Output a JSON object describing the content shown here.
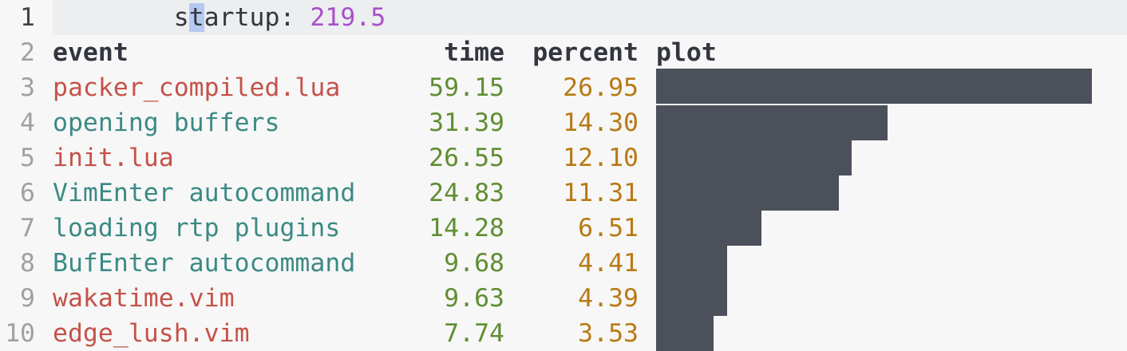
{
  "startup": {
    "label_before_cursor": "        s",
    "cursor_char": "t",
    "label_after_cursor": "artup: ",
    "value": "219.5"
  },
  "header": {
    "event": "event",
    "time": "time",
    "percent": "percent",
    "plot": "plot"
  },
  "line_numbers": [
    "1",
    "2",
    "3",
    "4",
    "5",
    "6",
    "7",
    "8",
    "9",
    "10"
  ],
  "rows": [
    {
      "event": "packer_compiled.lua",
      "time": "59.15",
      "percent": "26.95",
      "kind": "file"
    },
    {
      "event": "opening buffers",
      "time": "31.39",
      "percent": "14.30",
      "kind": "phase"
    },
    {
      "event": "init.lua",
      "time": "26.55",
      "percent": "12.10",
      "kind": "file"
    },
    {
      "event": "VimEnter autocommand",
      "time": "24.83",
      "percent": "11.31",
      "kind": "phase"
    },
    {
      "event": "loading rtp plugins",
      "time": "14.28",
      "percent": "6.51",
      "kind": "phase"
    },
    {
      "event": "BufEnter autocommand",
      "time": "9.68",
      "percent": "4.41",
      "kind": "phase"
    },
    {
      "event": "wakatime.vim",
      "time": "9.63",
      "percent": "4.39",
      "kind": "file"
    },
    {
      "event": "edge_lush.vim",
      "time": "7.74",
      "percent": "3.53",
      "kind": "file"
    }
  ],
  "colors": {
    "background": "#f7f7f7",
    "file_event": "#c5524a",
    "phase_event": "#3b8a84",
    "time": "#608e32",
    "percent": "#b87a14",
    "startup_value": "#a850c7",
    "bar": "#4b505b"
  }
}
